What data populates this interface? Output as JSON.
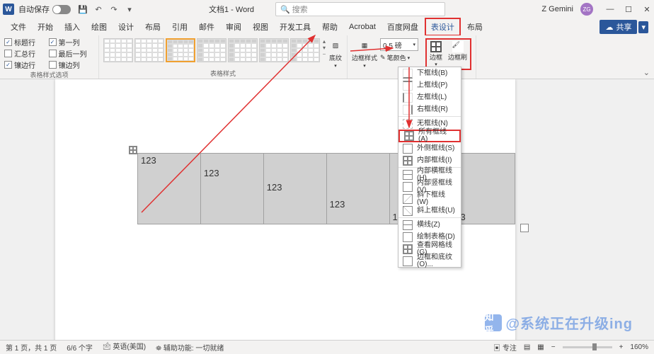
{
  "title": {
    "autosave": "自动保存",
    "doc": "文档1 - Word",
    "search_ph": "搜索",
    "user": "Z Gemini",
    "avatar": "ZG"
  },
  "qat": {
    "save": "💾",
    "undo": "↶",
    "redo": "↷",
    "more": "▾"
  },
  "winbtns": {
    "min": "—",
    "max": "☐",
    "close": "✕"
  },
  "tabs": [
    "文件",
    "开始",
    "插入",
    "绘图",
    "设计",
    "布局",
    "引用",
    "邮件",
    "审阅",
    "视图",
    "开发工具",
    "帮助",
    "Acrobat",
    "百度网盘",
    "表设计",
    "布局"
  ],
  "active_tab_index": 14,
  "share": "共享",
  "options_group": {
    "label": "表格样式选项",
    "opts": [
      {
        "label": "标题行",
        "checked": true
      },
      {
        "label": "第一列",
        "checked": true
      },
      {
        "label": "汇总行",
        "checked": false
      },
      {
        "label": "最后一列",
        "checked": false
      },
      {
        "label": "镶边行",
        "checked": true
      },
      {
        "label": "镶边列",
        "checked": false
      }
    ]
  },
  "styles_group": {
    "label": "表格样式"
  },
  "shading": {
    "label": "底纹"
  },
  "borders_group": {
    "label": "边框",
    "style_label": "边框样式",
    "width_value": "0.5 磅",
    "pen_label": "笔颜色",
    "border_btn": "边框",
    "brush_btn": "边框刷"
  },
  "dropdown": [
    {
      "label": "下框线(B)",
      "ico": "bot2"
    },
    {
      "label": "上框线(P)",
      "ico": "top2"
    },
    {
      "label": "左框线(L)",
      "ico": "left2"
    },
    {
      "label": "右框线(R)",
      "ico": "right2"
    },
    {
      "sep": true
    },
    {
      "label": "无框线(N)",
      "ico": "none"
    },
    {
      "label": "所有框线(A)",
      "ico": "all",
      "hl": true
    },
    {
      "label": "外侧框线(S)",
      "ico": ""
    },
    {
      "label": "内部框线(I)",
      "ico": "all"
    },
    {
      "sep": true
    },
    {
      "label": "内部横框线(H)",
      "ico": "hline"
    },
    {
      "label": "内部竖框线(V)",
      "ico": ""
    },
    {
      "label": "斜下框线(W)",
      "ico": "diag"
    },
    {
      "label": "斜上框线(U)",
      "ico": "diag2"
    },
    {
      "sep": true
    },
    {
      "label": "横线(Z)",
      "ico": "hline"
    },
    {
      "label": "绘制表格(D)",
      "ico": ""
    },
    {
      "label": "查看网格线(G)",
      "ico": "all"
    },
    {
      "label": "边框和底纹(O)...",
      "ico": ""
    }
  ],
  "table_cells": [
    "123",
    "123",
    "123",
    "123",
    "123",
    "123"
  ],
  "status": {
    "page": "第 1 页，共 1 页",
    "words": "6/6 个字",
    "lang": "英语(美国)",
    "acc": "辅助功能: 一切就绪",
    "focus": "专注",
    "zoom": "160%"
  },
  "watermark": "@系统正在升级ing",
  "zhihu": "知乎",
  "chart_data": null
}
